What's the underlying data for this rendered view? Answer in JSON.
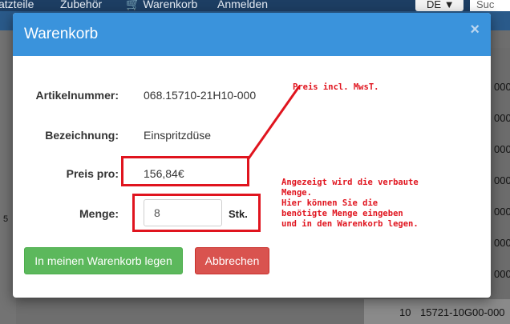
{
  "background": {
    "nav": [
      {
        "label": "atzteile",
        "icon": ""
      },
      {
        "label": "Zubehör",
        "icon": ""
      },
      {
        "label": "Warenkorb",
        "icon": "cart-icon"
      },
      {
        "label": "Anmelden",
        "icon": ""
      }
    ],
    "language": "DE",
    "search_placeholder": "Suc",
    "right_cells": [
      "000",
      "000",
      "000",
      "000",
      "000",
      "000",
      "000",
      "000"
    ],
    "sketch_number": "5",
    "bottom_row": {
      "pos": "10",
      "part": "15721-10G00-000"
    }
  },
  "modal": {
    "title": "Warenkorb",
    "close_label": "×",
    "fields": {
      "article_label": "Artikelnummer:",
      "article_value": "068.15710-21H10-000",
      "description_label": "Bezeichnung:",
      "description_value": "Einspritzdüse",
      "price_label": "Preis pro:",
      "price_value": "156,84€",
      "quantity_label": "Menge:",
      "quantity_value": "8",
      "quantity_unit": "Stk."
    },
    "buttons": {
      "add_to_cart": "In meinen Warenkorb legen",
      "cancel": "Abbrechen"
    }
  },
  "annotations": {
    "price_note": "Preis incl. MwsT.",
    "quantity_note": "Angezeigt wird die verbaute\nMenge.\nHier können Sie die\nbenötigte Menge eingeben\nund in den Warenkorb legen."
  },
  "colors": {
    "header_blue": "#3a93dc",
    "success_green": "#5cb85c",
    "danger_red": "#d9534f",
    "annotation_red": "#e0141e"
  }
}
